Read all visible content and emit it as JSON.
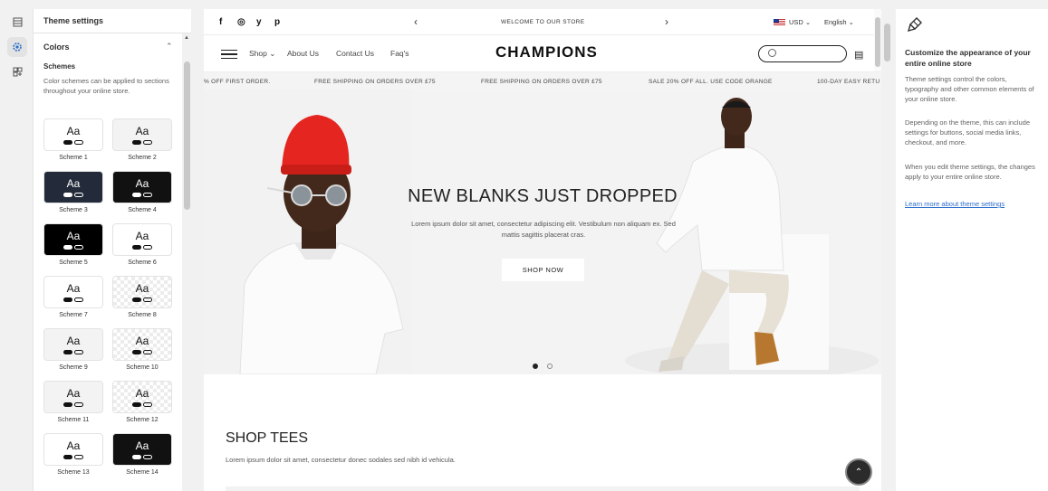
{
  "rail": {
    "icons": [
      "sections-icon",
      "theme-settings-icon",
      "app-blocks-icon"
    ]
  },
  "settings": {
    "header": "Theme settings",
    "group_title": "Colors",
    "schemes_label": "Schemes",
    "schemes_desc": "Color schemes can be applied to sections throughout your online store.",
    "schemes": [
      {
        "label": "Scheme 1",
        "bg": "#ffffff",
        "fg": "#111111"
      },
      {
        "label": "Scheme 2",
        "bg": "#f3f3f3",
        "fg": "#111111"
      },
      {
        "label": "Scheme 3",
        "bg": "#232b3a",
        "fg": "#ffffff"
      },
      {
        "label": "Scheme 4",
        "bg": "#111111",
        "fg": "#ffffff"
      },
      {
        "label": "Scheme 5",
        "bg": "#000000",
        "fg": "#ffffff"
      },
      {
        "label": "Scheme 6",
        "bg": "#ffffff",
        "fg": "#111111"
      },
      {
        "label": "Scheme 7",
        "bg": "#ffffff",
        "fg": "#111111"
      },
      {
        "label": "Scheme 8",
        "bg": "checker",
        "fg": "#111111"
      },
      {
        "label": "Scheme 9",
        "bg": "#f3f3f3",
        "fg": "#111111"
      },
      {
        "label": "Scheme 10",
        "bg": "checker",
        "fg": "#111111"
      },
      {
        "label": "Scheme 11",
        "bg": "#f3f3f3",
        "fg": "#111111"
      },
      {
        "label": "Scheme 12",
        "bg": "checker",
        "fg": "#111111"
      },
      {
        "label": "Scheme 13",
        "bg": "#ffffff",
        "fg": "#111111"
      },
      {
        "label": "Scheme 14",
        "bg": "#111111",
        "fg": "#ffffff"
      }
    ],
    "swatch_text": "Aa"
  },
  "preview": {
    "social": [
      "f",
      "◎",
      "y",
      "p"
    ],
    "announcement": "WELCOME TO OUR STORE",
    "prev_arrow": "‹",
    "next_arrow": "›",
    "currency": "USD ⌄",
    "language": "English ⌄",
    "nav": {
      "shop": "Shop ⌄",
      "about": "About Us",
      "contact": "Contact Us",
      "faq": "Faq's"
    },
    "logo": "CHAMPIONS",
    "marquee": [
      "% OFF FIRST ORDER.",
      "FREE SHIPPING ON ORDERS OVER £75",
      "FREE SHIPPING ON ORDERS OVER £75",
      "SALE 20% OFF ALL. USE CODE ORANGE",
      "100-DAY EASY RETU"
    ],
    "hero": {
      "title": "NEW BLANKS JUST DROPPED",
      "desc": "Lorem ipsum dolor sit amet, consectetur adipiscing elit. Vestibulum non aliquam ex. Sed mattis sagittis placerat cras.",
      "button": "SHOP NOW"
    },
    "section_title": "SHOP TEES",
    "section_desc": "Lorem ipsum dolor sit amet, consectetur donec sodales sed nibh id vehicula."
  },
  "info": {
    "title": "Customize the appearance of your entire online store",
    "p1": "Theme settings control the colors, typography and other common elements of your online store.",
    "p2": "Depending on the theme, this can include settings for buttons, social media links, checkout, and more.",
    "p3": "When you edit theme settings, the changes apply to your entire online store.",
    "link": "Learn more about theme settings"
  }
}
